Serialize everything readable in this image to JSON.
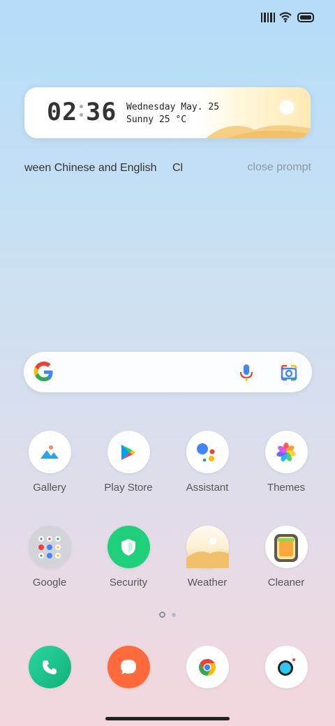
{
  "status_bar": {
    "signal_icon": "signal-bars-icon",
    "wifi_icon": "wifi-icon",
    "battery_icon": "battery-icon"
  },
  "clock_widget": {
    "hour": "02",
    "minute": "36",
    "date_line": "Wednesday May. 25",
    "weather_line": "Sunny 25 °C"
  },
  "marquee": {
    "text": "Switch between Chinese and English",
    "text_visible": "ween Chinese and English",
    "trailing": "Cl",
    "close_label": "close prompt"
  },
  "search": {
    "logo": "google-g-icon",
    "mic": "mic-icon",
    "lens": "google-lens-icon"
  },
  "apps_row1": [
    {
      "label": "Gallery",
      "icon": "gallery-icon"
    },
    {
      "label": "Play Store",
      "icon": "play-store-icon"
    },
    {
      "label": "Assistant",
      "icon": "assistant-icon"
    },
    {
      "label": "Themes",
      "icon": "themes-icon"
    }
  ],
  "apps_row2": [
    {
      "label": "Google",
      "icon": "google-folder-icon"
    },
    {
      "label": "Security",
      "icon": "security-icon"
    },
    {
      "label": "Weather",
      "icon": "weather-icon"
    },
    {
      "label": "Cleaner",
      "icon": "cleaner-icon"
    }
  ],
  "dock": [
    {
      "icon": "phone-icon"
    },
    {
      "icon": "messages-icon"
    },
    {
      "icon": "chrome-icon"
    },
    {
      "icon": "camera-icon"
    }
  ],
  "pages": {
    "count": 2,
    "current": 1
  },
  "colors": {
    "phone": "#1ec08a",
    "messages": "#ff6a3d",
    "security": "#1fcf7a"
  }
}
